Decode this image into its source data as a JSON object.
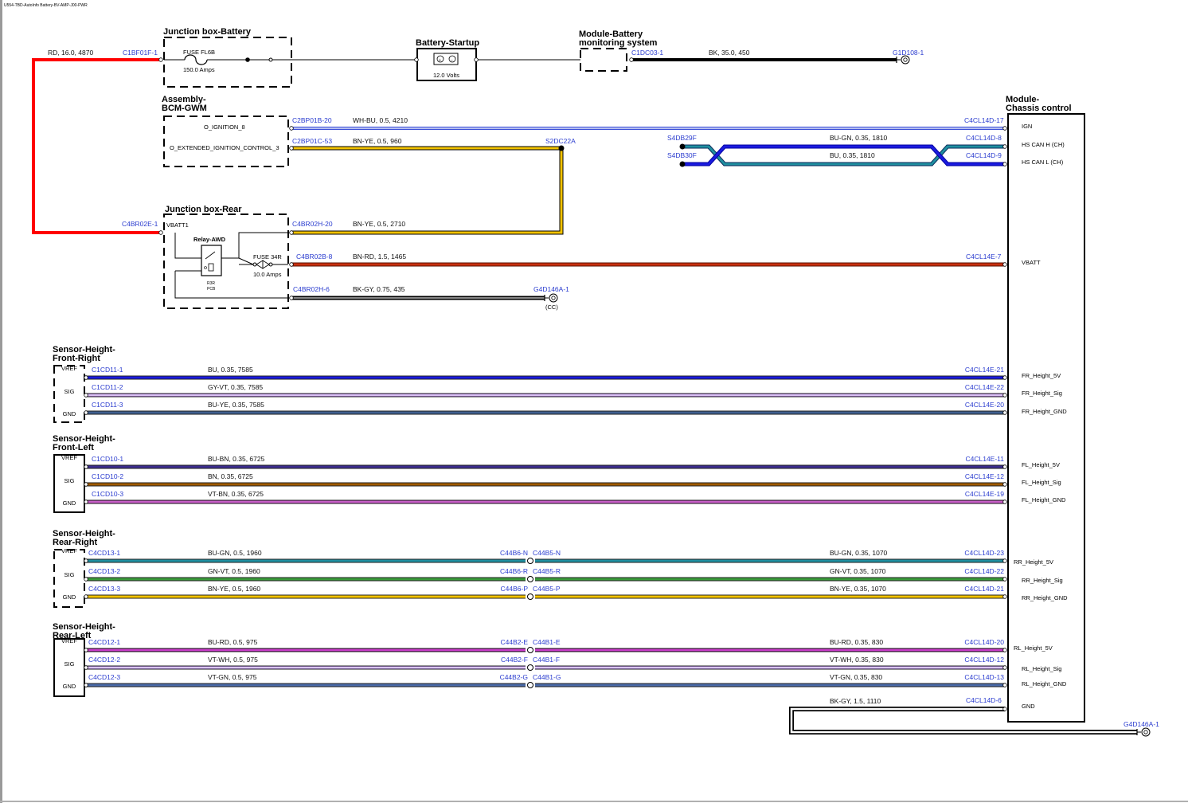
{
  "header": {
    "doc_id": "U554-TBD-AutoInfo Battery-BV-AMP-J00-PWR"
  },
  "colors": {
    "RD": "#ff0000",
    "BK": "#000000",
    "WH-BU": "#3a4fd8",
    "BN-YE": "#f2c200",
    "BU-GN": "#1f8fa0",
    "BU": "#1a1adf",
    "BN-RD": "#c03010",
    "BK-GY": "#555555",
    "GY-VT": "#b680e8",
    "BU-YE": "#3f5f8f",
    "BU-BN": "#3b2c8f",
    "BN": "#a05a00",
    "VT-BN": "#b040b0",
    "GN-VT": "#3a9a3a",
    "BU-RD": "#9a1a9a",
    "VT-WH": "#b58ae8",
    "VT-GN": "#4a6aa8"
  },
  "components": {
    "jb_battery": {
      "title": "Junction box-Battery",
      "fuse": "FUSE FL6B",
      "amps": "150.0 Amps"
    },
    "battery": {
      "title": "Battery-Startup",
      "volts": "12.0 Volts"
    },
    "bms": {
      "title1": "Module-Battery",
      "title2": "monitoring system"
    },
    "bcm": {
      "title1": "Assembly-",
      "title2": "BCM-GWM",
      "pin1": "O_IGNITION_8",
      "pin2": "O_EXTENDED_IGNITION_CONTROL_3"
    },
    "jb_rear": {
      "title": "Junction box-Rear",
      "pin": "VBATT1",
      "relay": "Relay-AWD",
      "fuse": "FUSE 34R",
      "amps": "10.0 Amps",
      "loc1": "R3R",
      "loc2": "PCB"
    },
    "ccm": {
      "title1": "Module-",
      "title2": "Chassis control",
      "pins": [
        "IGN",
        "HS CAN H (CH)",
        "HS CAN L (CH)",
        "VBATT",
        "FR_Height_5V",
        "FR_Height_Sig",
        "FR_Height_GND",
        "FL_Height_5V",
        "FL_Height_Sig",
        "FL_Height_GND",
        "RR_Height_5V",
        "RR_Height_Sig",
        "RR_Height_GND",
        "RL_Height_5V",
        "RL_Height_Sig",
        "RL_Height_GND",
        "GND"
      ]
    }
  },
  "sensors": [
    {
      "title1": "Sensor-Height-",
      "title2": "Front-Right",
      "pins": [
        "VREF",
        "SIG",
        "GND"
      ]
    },
    {
      "title1": "Sensor-Height-",
      "title2": "Front-Left",
      "pins": [
        "VREF",
        "SIG",
        "GND"
      ]
    },
    {
      "title1": "Sensor-Height-",
      "title2": "Rear-Right",
      "pins": [
        "VREF",
        "SIG",
        "GND"
      ]
    },
    {
      "title1": "Sensor-Height-",
      "title2": "Rear-Left",
      "pins": [
        "VREF",
        "SIG",
        "GND"
      ]
    }
  ],
  "connectors": {
    "bat_in": "C1BF01F-1",
    "bms": "C1DC03-1",
    "g1": "G1D108-1",
    "bcm1": "C2BP01B-20",
    "bcm2": "C2BP01C-53",
    "splice1": "S2DC22A",
    "splice2": "S4DB29F",
    "splice3": "S4DB30F",
    "ccm_ign": "C4CL14D-17",
    "ccm_canh": "C4CL14D-8",
    "ccm_canl": "C4CL14D-9",
    "jbr_in": "C4BR02E-1",
    "jbr_h20": "C4BR02H-20",
    "jbr_b8": "C4BR02B-8",
    "jbr_h6": "C4BR02H-6",
    "ccm_vbatt": "C4CL14E-7",
    "g2": "G4D146A-1",
    "cc": "(CC)",
    "fr1": "C1CD11-1",
    "fr2": "C1CD11-2",
    "fr3": "C1CD11-3",
    "ccm_fr1": "C4CL14E-21",
    "ccm_fr2": "C4CL14E-22",
    "ccm_fr3": "C4CL14E-20",
    "fl1": "C1CD10-1",
    "fl2": "C1CD10-2",
    "fl3": "C1CD10-3",
    "ccm_fl1": "C4CL14E-11",
    "ccm_fl2": "C4CL14E-12",
    "ccm_fl3": "C4CL14E-19",
    "rr1": "C4CD13-1",
    "rr2": "C4CD13-2",
    "rr3": "C4CD13-3",
    "rr_il1a": "C44B6-N",
    "rr_il1b": "C44B5-N",
    "rr_il2a": "C44B6-R",
    "rr_il2b": "C44B5-R",
    "rr_il3a": "C44B6-P",
    "rr_il3b": "C44B5-P",
    "ccm_rr1": "C4CL14D-23",
    "ccm_rr2": "C4CL14D-22",
    "ccm_rr3": "C4CL14D-21",
    "rl1": "C4CD12-1",
    "rl2": "C4CD12-2",
    "rl3": "C4CD12-3",
    "rl_il1a": "C44B2-E",
    "rl_il1b": "C44B1-E",
    "rl_il2a": "C44B2-F",
    "rl_il2b": "C44B1-F",
    "rl_il3a": "C44B2-G",
    "rl_il3b": "C44B1-G",
    "ccm_rl1": "C4CL14D-20",
    "ccm_rl2": "C4CL14D-12",
    "ccm_rl3": "C4CL14D-13",
    "ccm_gnd": "C4CL14D-6",
    "g3": "G4D146A-1"
  },
  "wires": {
    "bat_in": "RD,  16.0,  4870",
    "bms": "BK,  35.0,  450",
    "ign": "WH-BU,  0.5,  4210",
    "ext": "BN-YE,  0.5,  960",
    "canh": "BU-GN,  0.35,  1810",
    "canl": "BU,  0.35,  1810",
    "jbr_h20": "BN-YE,  0.5,  2710",
    "vbatt": "BN-RD,  1.5,  1465",
    "jbr_gnd": "BK-GY,  0.75,  435",
    "fr1": "BU,  0.35,  7585",
    "fr2": "GY-VT,  0.35,  7585",
    "fr3": "BU-YE,  0.35,  7585",
    "fl1": "BU-BN,  0.35,  6725",
    "fl2": "BN,  0.35,  6725",
    "fl3": "VT-BN,  0.35,  6725",
    "rr1a": "BU-GN,  0.5,  1960",
    "rr2a": "GN-VT,  0.5,  1960",
    "rr3a": "BN-YE,  0.5,  1960",
    "rr1b": "BU-GN,  0.35,  1070",
    "rr2b": "GN-VT,  0.35,  1070",
    "rr3b": "BN-YE,  0.35,  1070",
    "rl1a": "BU-RD,  0.5,  975",
    "rl2a": "VT-WH,  0.5,  975",
    "rl3a": "VT-GN,  0.5,  975",
    "rl1b": "BU-RD,  0.35,  830",
    "rl2b": "VT-WH,  0.35,  830",
    "rl3b": "VT-GN,  0.35,  830",
    "ccm_gnd": "BK-GY,  1.5,  1110"
  }
}
